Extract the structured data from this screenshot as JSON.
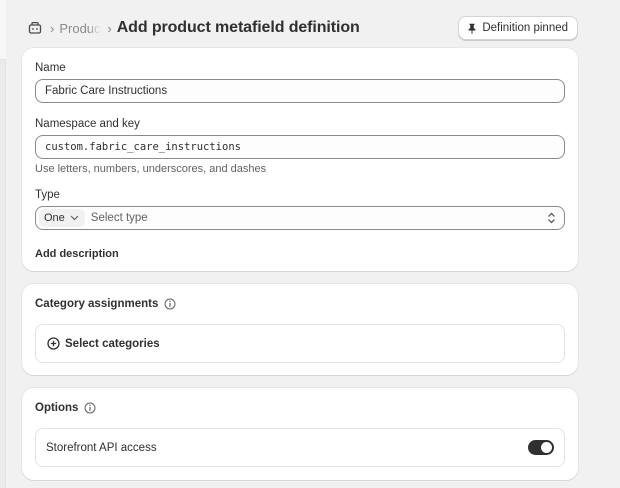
{
  "breadcrumb": {
    "icon": "metafield-store-icon",
    "parent_label": "Products"
  },
  "page": {
    "title": "Add product metafield definition"
  },
  "pin_button": {
    "label": "Definition pinned",
    "icon": "pin-icon"
  },
  "definition": {
    "name_label": "Name",
    "name_value": "Fabric Care Instructions",
    "namespace_label": "Namespace and key",
    "namespace_value": "custom.fabric_care_instructions",
    "namespace_help": "Use letters, numbers, underscores, and dashes",
    "type_label": "Type",
    "type_cardinality": "One",
    "type_placeholder": "Select type",
    "add_description": "Add description"
  },
  "categories": {
    "title": "Category assignments",
    "select_label": "Select categories"
  },
  "options": {
    "title": "Options",
    "storefront_label": "Storefront API access",
    "storefront_enabled": true
  },
  "colors": {
    "background": "#f1f1f1",
    "text": "#303030",
    "muted": "#8a8a8a",
    "toggle_on": "#303030"
  }
}
